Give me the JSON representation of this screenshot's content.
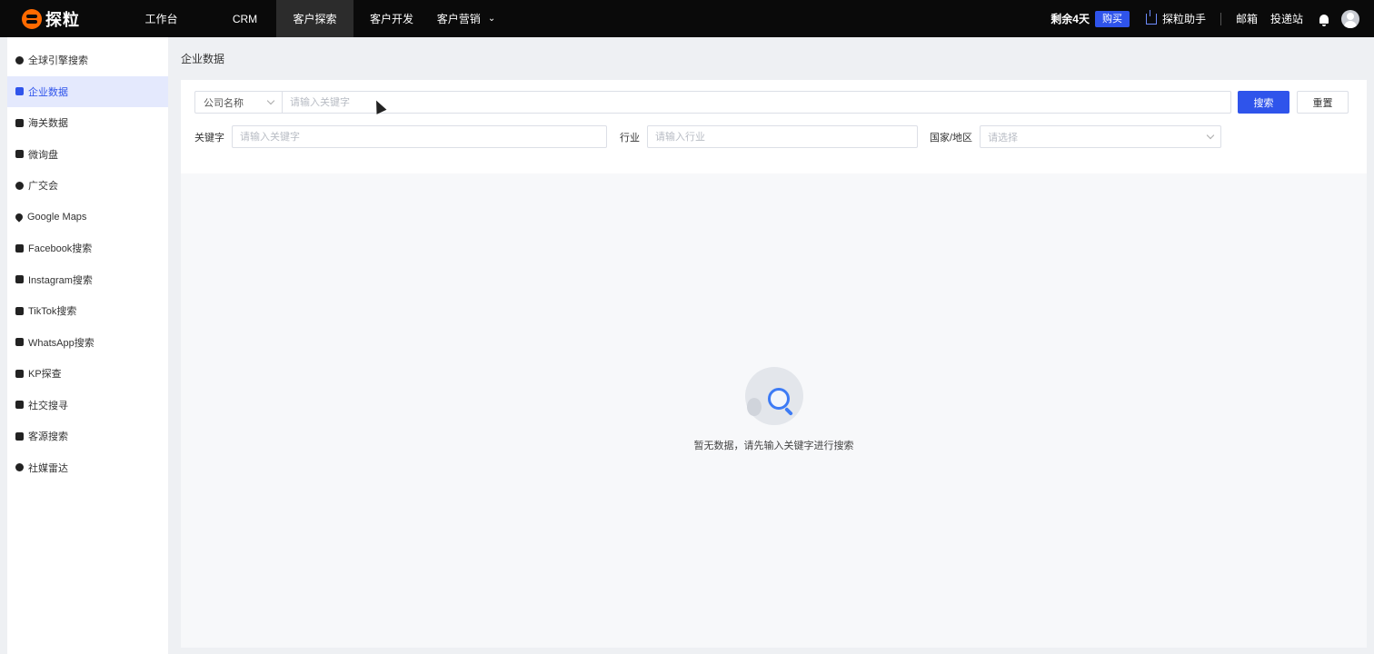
{
  "app": {
    "logo_text": "探粒",
    "brand_color": "#ff6a00",
    "accent_color": "#2f54eb"
  },
  "nav": {
    "items": [
      {
        "label": "工作台"
      },
      {
        "label": "CRM"
      },
      {
        "label": "客户探索",
        "active": true
      },
      {
        "label": "客户开发"
      },
      {
        "label": "客户营销",
        "has_dropdown": true
      }
    ]
  },
  "topbar": {
    "remaining": "剩余4天",
    "buy_label": "购买",
    "helper_label": "探粒助手",
    "mail_label": "邮箱",
    "site_label": "投递站",
    "bell_icon": "bell-icon",
    "avatar_icon": "user-avatar-icon"
  },
  "sidebar": {
    "items": [
      {
        "label": "全球引擎搜索",
        "icon": "globe-icon"
      },
      {
        "label": "企业数据",
        "icon": "building-icon",
        "active": true
      },
      {
        "label": "海关数据",
        "icon": "customs-icon"
      },
      {
        "label": "微询盘",
        "icon": "message-icon"
      },
      {
        "label": "广交会",
        "icon": "gear-icon"
      },
      {
        "label": "Google Maps",
        "icon": "map-pin-icon"
      },
      {
        "label": "Facebook搜索",
        "icon": "facebook-icon"
      },
      {
        "label": "Instagram搜索",
        "icon": "instagram-icon"
      },
      {
        "label": "TikTok搜索",
        "icon": "tiktok-icon"
      },
      {
        "label": "WhatsApp搜索",
        "icon": "whatsapp-icon"
      },
      {
        "label": "KP探查",
        "icon": "contact-icon"
      },
      {
        "label": "社交搜寻",
        "icon": "social-icon"
      },
      {
        "label": "客源搜索",
        "icon": "source-icon"
      },
      {
        "label": "社媒雷达",
        "icon": "radar-icon"
      }
    ]
  },
  "main": {
    "page_title": "企业数据",
    "search": {
      "type_selected": "公司名称",
      "keyword_placeholder": "请输入关键字",
      "search_label": "搜索",
      "reset_label": "重置"
    },
    "filters": {
      "keyword_label": "关键字",
      "keyword_placeholder": "请输入关键字",
      "industry_label": "行业",
      "industry_placeholder": "请输入行业",
      "country_label": "国家/地区",
      "country_placeholder": "请选择"
    },
    "empty_text": "暂无数据，请先输入关键字进行搜索"
  }
}
